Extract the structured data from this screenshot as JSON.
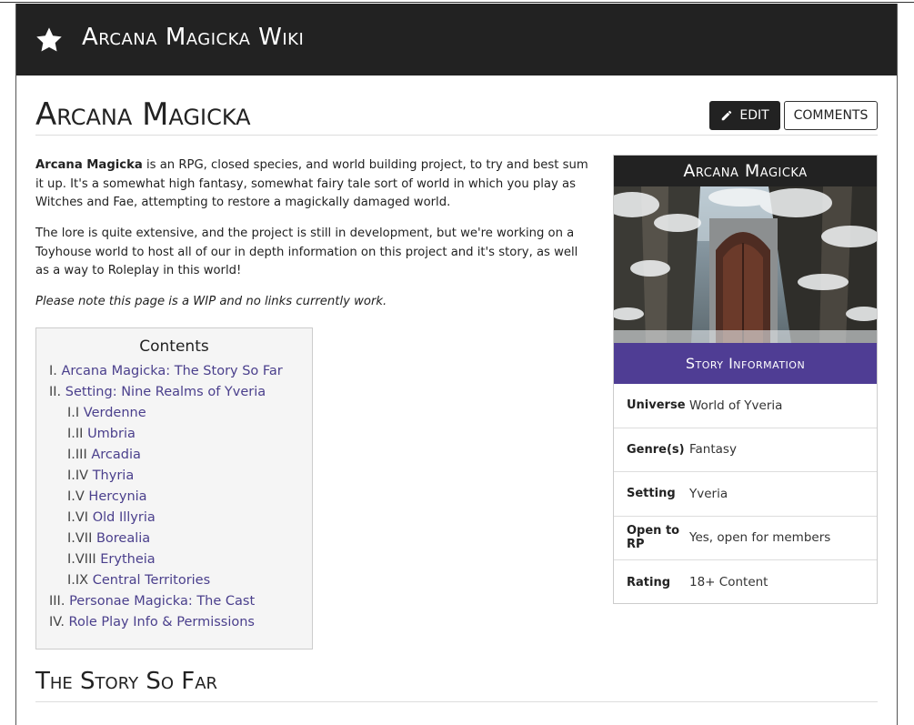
{
  "header": {
    "title": "Arcana Magicka Wiki",
    "icon": "star-icon"
  },
  "page": {
    "title": "Arcana Magicka",
    "edit_label": "EDIT",
    "comments_label": "COMMENTS"
  },
  "intro": {
    "p1_bold": "Arcana Magicka",
    "p1_rest": " is an RPG, closed species, and world building project, to try and best sum it up. It's a somewhat high fantasy, somewhat fairy tale sort of world in which you play as Witches and Fae, attempting to restore a magickally damaged world.",
    "p2": "The lore is quite extensive, and the project is still in development, but we're working on a Toyhouse world to host all of our in depth information on this project and it's story, as well as a way to Roleplay in this world!",
    "p3": "Please note this page is a WIP and no links currently work."
  },
  "toc": {
    "title": "Contents",
    "items": [
      {
        "num": "I. ",
        "label": "Arcana Magicka: The Story So Far",
        "sub": false
      },
      {
        "num": "II. ",
        "label": "Setting: Nine Realms of Yveria",
        "sub": false
      },
      {
        "num": "I.I ",
        "label": "Verdenne",
        "sub": true
      },
      {
        "num": "I.II ",
        "label": "Umbria",
        "sub": true
      },
      {
        "num": "I.III ",
        "label": "Arcadia",
        "sub": true
      },
      {
        "num": "I.IV ",
        "label": "Thyria",
        "sub": true
      },
      {
        "num": "I.V ",
        "label": "Hercynia",
        "sub": true
      },
      {
        "num": "I.VI ",
        "label": "Old Illyria",
        "sub": true
      },
      {
        "num": "I.VII ",
        "label": "Borealia",
        "sub": true
      },
      {
        "num": "I.VIII ",
        "label": "Erytheia",
        "sub": true
      },
      {
        "num": "I.IX ",
        "label": "Central Territories",
        "sub": true
      },
      {
        "num": "III. ",
        "label": "Personae Magicka: The Cast",
        "sub": false
      },
      {
        "num": "IV. ",
        "label": "Role Play Info & Permissions",
        "sub": false
      }
    ]
  },
  "infobox": {
    "title": "Arcana Magicka",
    "section": "Story Information",
    "rows": [
      {
        "label": "Universe",
        "value": "World of Yveria"
      },
      {
        "label": "Genre(s)",
        "value": "Fantasy"
      },
      {
        "label": "Setting",
        "value": "Yveria"
      },
      {
        "label": "Open to RP",
        "value": "Yes, open for members"
      },
      {
        "label": "Rating",
        "value": "18+ Content"
      }
    ]
  },
  "section": {
    "title": "The Story So Far"
  },
  "colors": {
    "header_bg": "#222222",
    "accent": "#4f3d94",
    "link": "#4a3f8c"
  }
}
